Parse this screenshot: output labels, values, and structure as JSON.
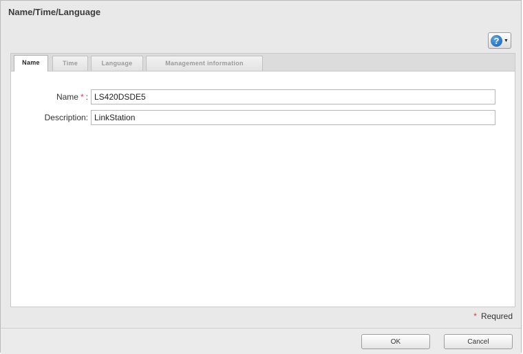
{
  "dialog": {
    "title": "Name/Time/Language",
    "help_button": {
      "icon": "help-icon",
      "glyph": "?",
      "caret": "▼"
    }
  },
  "tabs": [
    {
      "label": "Name",
      "active": true
    },
    {
      "label": "Time",
      "active": false
    },
    {
      "label": "Language",
      "active": false
    },
    {
      "label": "Management information",
      "active": false
    }
  ],
  "form": {
    "name": {
      "label": "Name",
      "required_mark": "*",
      "colon": ":",
      "value": "LS420DSDE5"
    },
    "description": {
      "label": "Description:",
      "value": "LinkStation"
    }
  },
  "required_note": {
    "mark": "*",
    "text": "Requred"
  },
  "buttons": {
    "ok": "OK",
    "cancel": "Cancel"
  },
  "colors": {
    "required": "#e23a3a",
    "help_icon": "#1a5fb4"
  }
}
